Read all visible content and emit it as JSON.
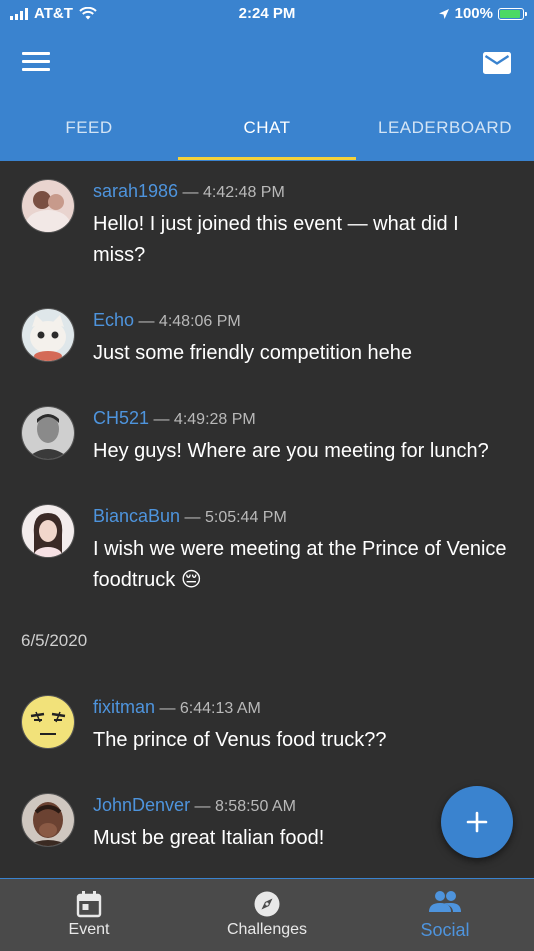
{
  "status_bar": {
    "carrier": "AT&T",
    "time": "2:24 PM",
    "battery": "100%"
  },
  "tabs": [
    {
      "label": "FEED",
      "active": false
    },
    {
      "label": "CHAT",
      "active": true
    },
    {
      "label": "LEADERBOARD",
      "active": false
    }
  ],
  "messages": [
    {
      "user": "sarah1986",
      "time": "4:42:48 PM",
      "text": "Hello! I just joined this event — what did I miss?"
    },
    {
      "user": "Echo",
      "time": "4:48:06 PM",
      "text": "Just some friendly competition hehe"
    },
    {
      "user": "CH521",
      "time": "4:49:28 PM",
      "text": "Hey guys! Where are you meeting for lunch?"
    },
    {
      "user": "BiancaBun",
      "time": "5:05:44 PM",
      "text": "I wish we were meeting at the Prince of Venice foodtruck 😔"
    },
    {
      "user": "fixitman",
      "time": "6:44:13 AM",
      "text": "The prince of Venus food truck??"
    },
    {
      "user": "JohnDenver",
      "time": "8:58:50 AM",
      "text": "Must be great Italian food!"
    }
  ],
  "date_separator": "6/5/2020",
  "fab": {
    "icon": "plus-icon"
  },
  "bottom_nav": [
    {
      "label": "Event",
      "icon": "calendar-icon",
      "active": false
    },
    {
      "label": "Challenges",
      "icon": "compass-icon",
      "active": false
    },
    {
      "label": "Social",
      "icon": "people-icon",
      "active": true
    }
  ],
  "colors": {
    "primary": "#3a83cf",
    "background": "#2f2f2f",
    "tab_indicator": "#f4d23b",
    "username": "#4e94dd"
  }
}
